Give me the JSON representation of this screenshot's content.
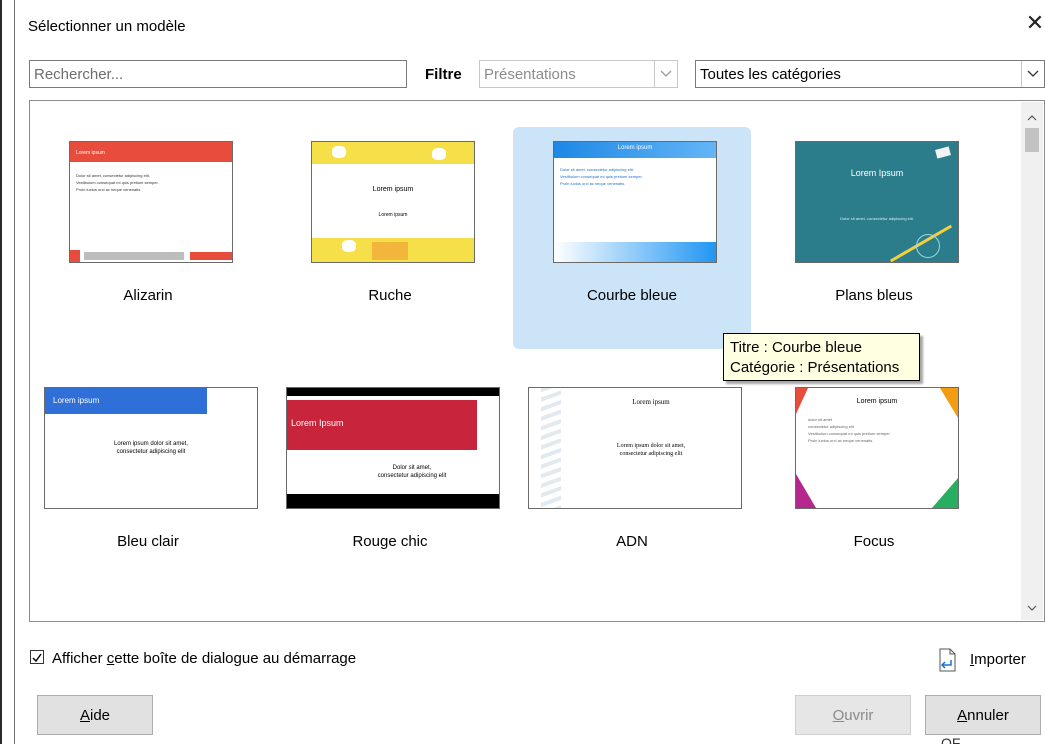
{
  "dialog": {
    "title": "Sélectionner un modèle",
    "close_symbol": "✕"
  },
  "toolbar": {
    "search_placeholder": "Rechercher...",
    "filter_label": "Filtre",
    "filter_value": "Présentations",
    "category_value": "Toutes les catégories"
  },
  "thumbs": {
    "lorem": "Lorem ipsum",
    "lorem_upper": "Lorem Ipsum",
    "dolor_line": "Dolor sit amet, consectetur adipiscing elit.",
    "dolor_line2": "Dolor sit amet,",
    "dolor_line3": "consectetur adipiscing elit",
    "lorem_long1": "Lorem ipsum dolor sit amet,",
    "lorem_long2": "consectetur adipiscing elit",
    "bullet2": "Vestibulum consequat mi quis pretium semper.",
    "bullet3": "Proin luctus orci ac neque venenatis.",
    "focus1": "dolor sit amet",
    "focus2": "consectetur adipiscing elit",
    "focus3": "Vestibulum consequat mi quis pretium semper",
    "focus4": "Proin luctus orci ac neque venenatis."
  },
  "templates": [
    {
      "name": "Alizarin",
      "selected": false
    },
    {
      "name": "Ruche",
      "selected": false
    },
    {
      "name": "Courbe bleue",
      "selected": true
    },
    {
      "name": "Plans bleus",
      "selected": false
    },
    {
      "name": "Bleu clair",
      "selected": false
    },
    {
      "name": "Rouge chic",
      "selected": false
    },
    {
      "name": "ADN",
      "selected": false
    },
    {
      "name": "Focus",
      "selected": false
    }
  ],
  "tooltip": {
    "line1": "Titre : Courbe bleue",
    "line2": "Catégorie : Présentations"
  },
  "footer": {
    "checkbox_checked": true,
    "checkbox_label_pre": "Afficher ",
    "checkbox_label_u": "c",
    "checkbox_label_post": "ette boîte de dialogue au démarrage",
    "import_u": "I",
    "import_rest": "mporter",
    "help_u": "A",
    "help_rest": "ide",
    "open_u": "O",
    "open_rest": "uvrir",
    "cancel_u": "A",
    "cancel_rest": "nnuler",
    "cut_text": "OF"
  },
  "colors": {
    "selection": "#cce4f7",
    "tooltip_bg": "#ffffe1",
    "alizarin_red": "#e74c3c",
    "rouge_chic": "#c8253c"
  }
}
